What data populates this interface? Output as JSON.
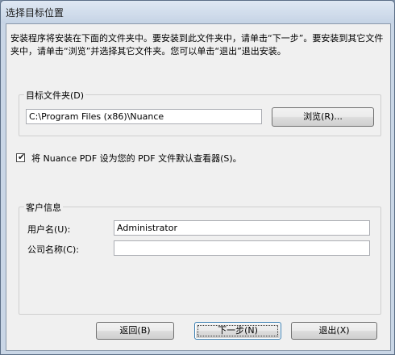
{
  "window": {
    "title": "选择目标位置"
  },
  "intro": {
    "text": "安装程序将安装在下面的文件夹中。要安装到此文件夹中，请单击“下一步”。要安装到其它文件夹中，请单击“浏览”并选择其它文件夹。您可以单击“退出”退出安装。"
  },
  "destination": {
    "group_label": "目标文件夹(D)",
    "path_value": "C:\\Program Files (x86)\\Nuance",
    "browse_label": "浏览(R)..."
  },
  "default_viewer": {
    "checked": true,
    "label": "将 Nuance PDF 设为您的 PDF 文件默认查看器(S)。"
  },
  "customer": {
    "group_label": "客户信息",
    "username_label": "用户名(U):",
    "username_value": "Administrator",
    "company_label": "公司名称(C):",
    "company_value": ""
  },
  "buttons": {
    "back": "返回(B)",
    "next": "下一步(N)",
    "exit": "退出(X)"
  }
}
